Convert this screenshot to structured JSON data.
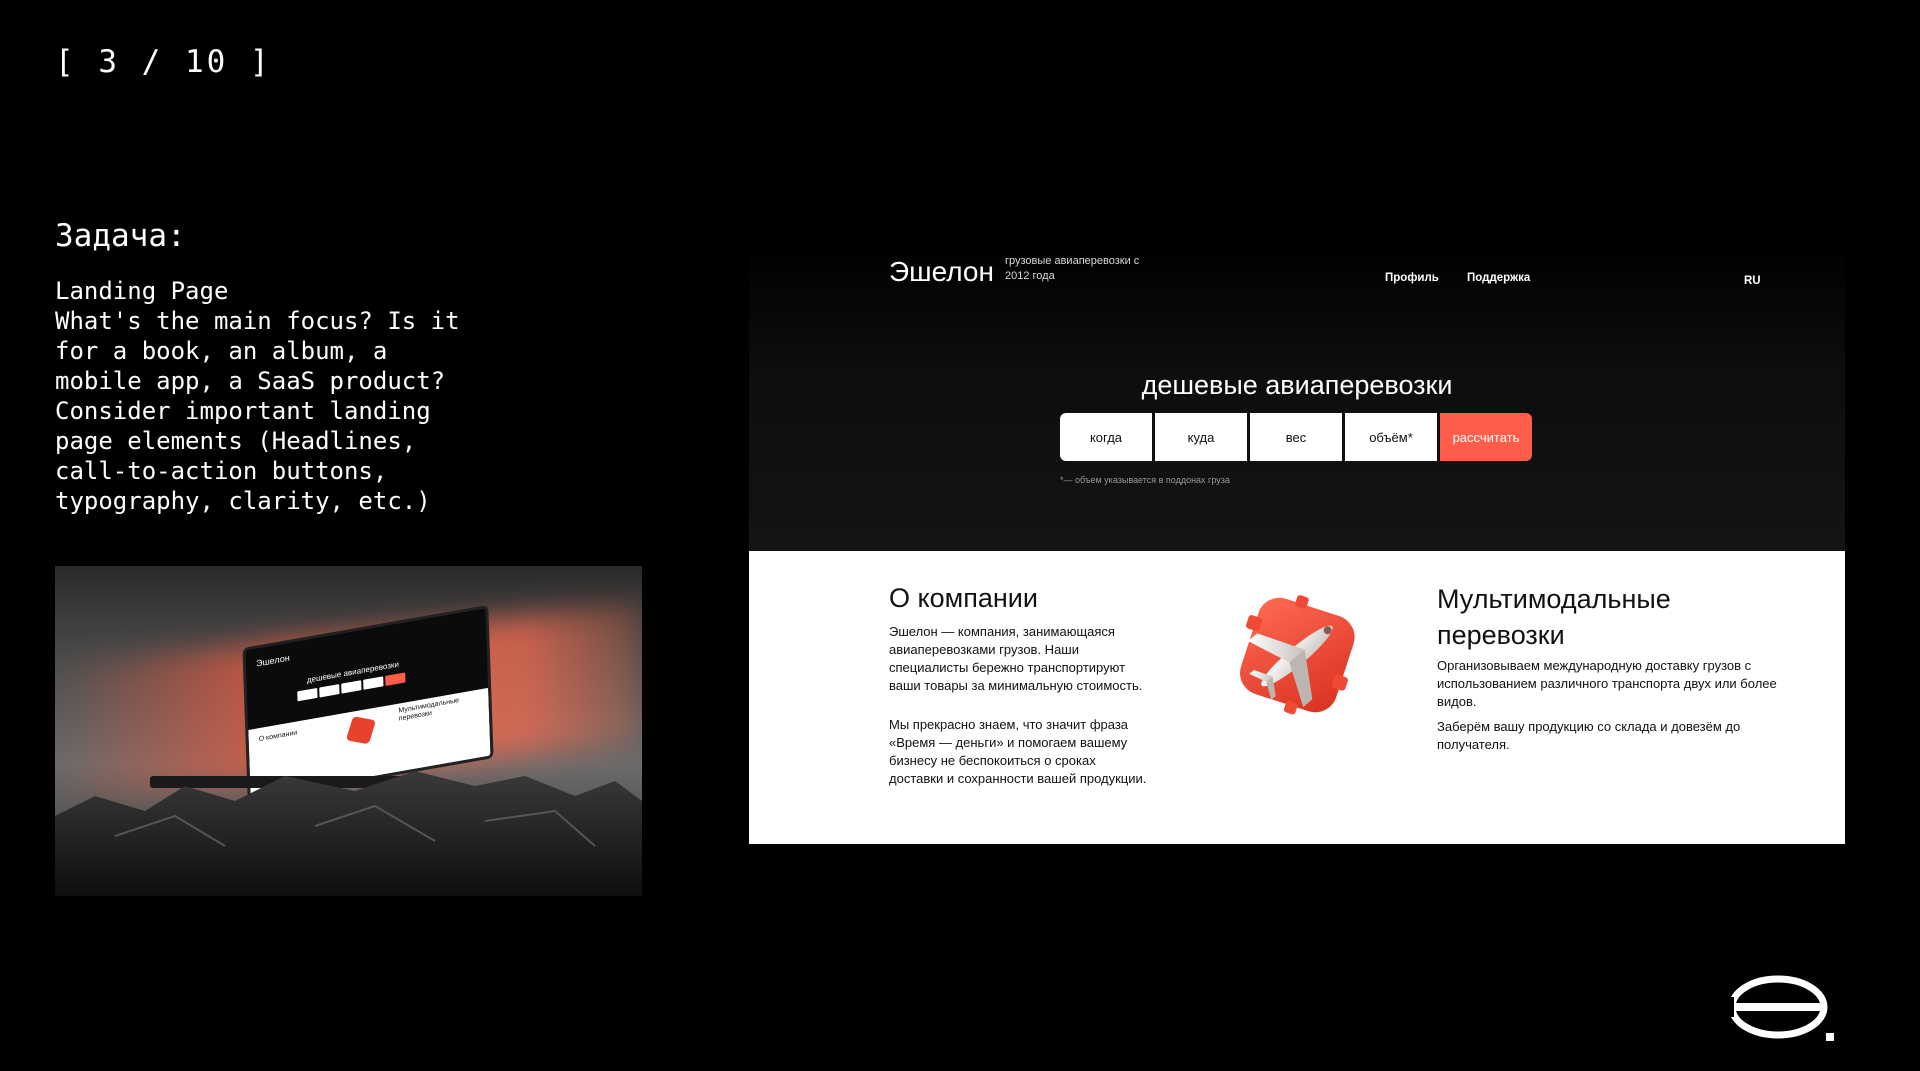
{
  "slide": {
    "counter": "[ 3 / 10 ]"
  },
  "task": {
    "title": "Задача:",
    "lines": [
      "Landing Page",
      "What's the main focus? Is it",
      "for a book, an album, a",
      "mobile app, a SaaS product?",
      "Consider important landing",
      "page elements (Headlines,",
      "call-to-action buttons,",
      "typography, clarity, etc.)"
    ]
  },
  "mockup": {
    "brand": "Эшелон",
    "title": "дешевые авиаперевозки",
    "about": "О компании",
    "multi": "Мультимодальные перевозки"
  },
  "landing": {
    "brand": "Эшелон",
    "tagline": "грузовые авиаперевозки с 2012 года",
    "nav": {
      "profile": "Профиль",
      "support": "Поддержка",
      "lang": "RU"
    },
    "hero_title": "дешевые авиаперевозки",
    "form": {
      "when": "когда",
      "where": "куда",
      "weight": "вес",
      "volume": "объём*",
      "cta": "рассчитать"
    },
    "form_note": "*— объем указывается в поддонах груза",
    "about": {
      "title": "О компании",
      "p1": "Эшелон — компания, занимающаяся авиаперевозками грузов. Наши специалисты бережно транспортируют ваши товары за минимальную стоимость.",
      "p2": "Мы прекрасно знаем, что значит фраза «Время — деньги» и помогаем вашему бизнесу не беспокоиться о сроках доставки и сохранности вашей продукции."
    },
    "multimodal": {
      "title": "Мультимодальные перевозки",
      "p1": "Организовываем международную доставку грузов с использованием различного транспорта двух или более видов.",
      "p2": "Заберём вашу продукцию со склада и довезём до получателя."
    }
  },
  "colors": {
    "accent": "#ff5c4a",
    "background": "#000000",
    "hero": "#0d0d0d"
  },
  "icons": {
    "plane": "plane-3d-icon",
    "logo": "eshelon-logo-icon"
  }
}
